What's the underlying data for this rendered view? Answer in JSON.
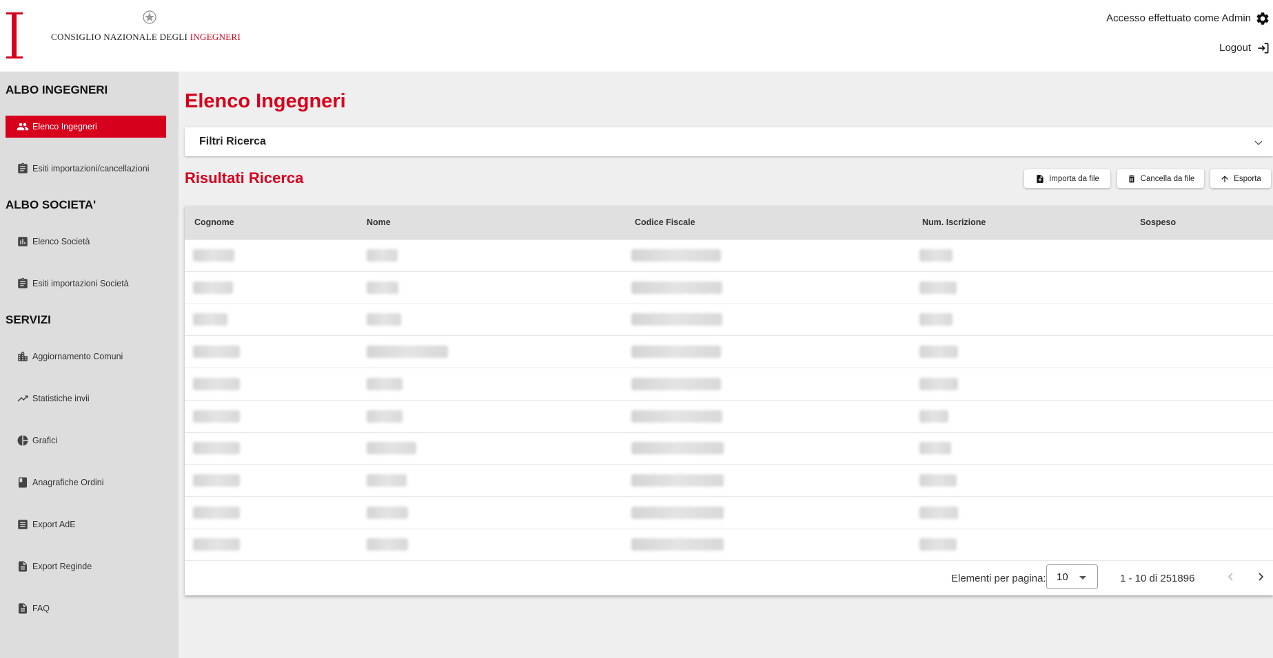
{
  "header": {
    "org_name_plain": "CONSIGLIO NAZIONALE DEGLI ",
    "org_name_accent": "INGEGNERI",
    "login_info": "Accesso effettuato come Admin",
    "logout_label": "Logout"
  },
  "sidebar": {
    "sections": [
      {
        "title": "ALBO INGEGNERI",
        "items": [
          {
            "label": "Elenco Ingegneri",
            "icon": "people-icon",
            "active": true
          },
          {
            "label": "Esiti importazioni/cancellazioni",
            "icon": "clipboard-icon"
          }
        ]
      },
      {
        "title": "ALBO SOCIETA'",
        "items": [
          {
            "label": "Elenco Società",
            "icon": "bar-chart-icon"
          },
          {
            "label": "Esiti importazioni Società",
            "icon": "clipboard-icon"
          }
        ]
      },
      {
        "title": "SERVIZI",
        "items": [
          {
            "label": "Aggiornamento Comuni",
            "icon": "buildings-icon"
          },
          {
            "label": "Statistiche invii",
            "icon": "trending-up-icon"
          },
          {
            "label": "Grafici",
            "icon": "pie-chart-icon"
          },
          {
            "label": "Anagrafiche Ordini",
            "icon": "book-icon"
          },
          {
            "label": "Export AdE",
            "icon": "list-icon"
          },
          {
            "label": "Export Reginde",
            "icon": "document-icon"
          },
          {
            "label": "FAQ",
            "icon": "document-icon"
          }
        ]
      }
    ]
  },
  "main": {
    "title": "Elenco Ingegneri",
    "filters_label": "Filtri Ricerca",
    "results_title": "Risultati Ricerca",
    "buttons": {
      "import": "Importa da file",
      "delete": "Cancella da file",
      "export": "Esporta"
    },
    "table": {
      "columns": [
        "Cognome",
        "Nome",
        "Codice Fiscale",
        "Num. Iscrizione",
        "Sospeso"
      ],
      "rows_redacted": 10
    },
    "paginator": {
      "label": "Elementi per pagina:",
      "page_size": "10",
      "range": "1 - 10 di 251896"
    }
  },
  "colors": {
    "accent": "#d6001c",
    "sidebar_bg": "#dddddd",
    "content_bg": "#efefef"
  }
}
